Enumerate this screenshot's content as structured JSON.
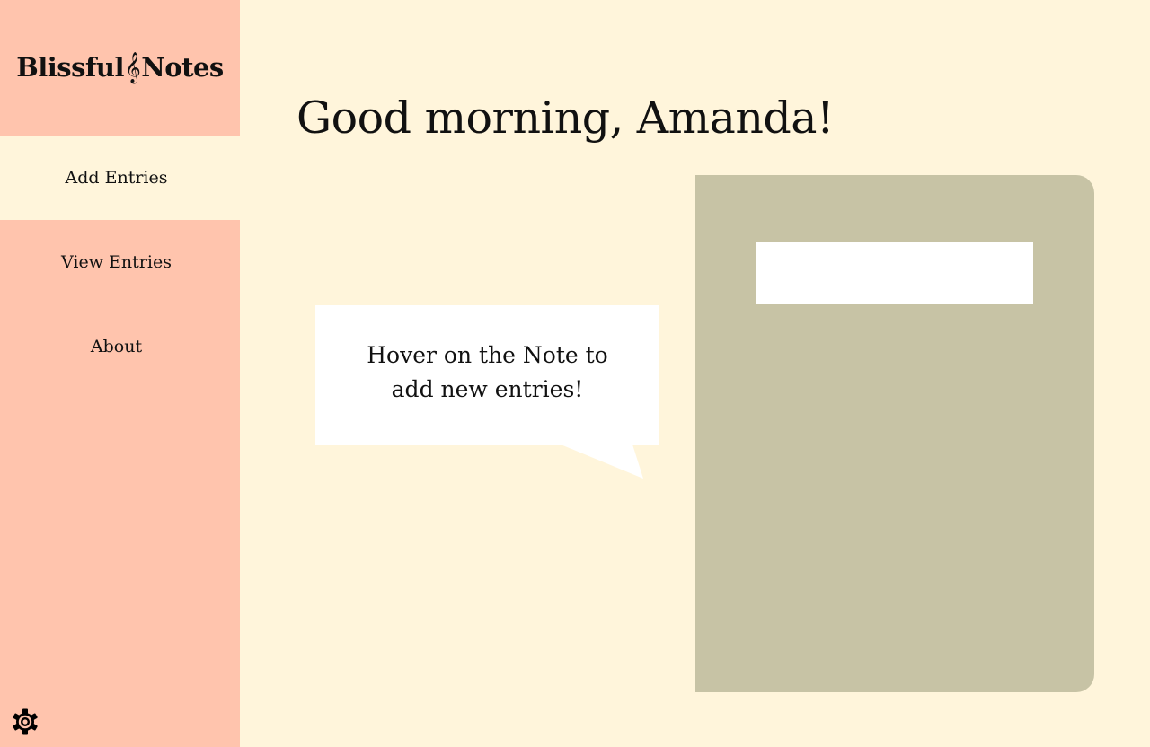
{
  "brand": {
    "name_part1": "Blissful",
    "symbol": "𝄞",
    "name_part2": "Notes"
  },
  "nav": {
    "items": [
      {
        "label": "Add Entries",
        "active": true
      },
      {
        "label": "View Entries",
        "active": false
      },
      {
        "label": "About",
        "active": false
      }
    ]
  },
  "settings": {
    "icon": "gear-icon"
  },
  "main": {
    "greeting": "Good morning, Amanda!",
    "hint_line1": "Hover on the Note to",
    "hint_line2": "add new entries!",
    "note_label": ""
  },
  "colors": {
    "sidebar": "#ffc4ad",
    "background": "#fff5db",
    "note": "#c7c3a5",
    "bubble": "#ffffff"
  }
}
